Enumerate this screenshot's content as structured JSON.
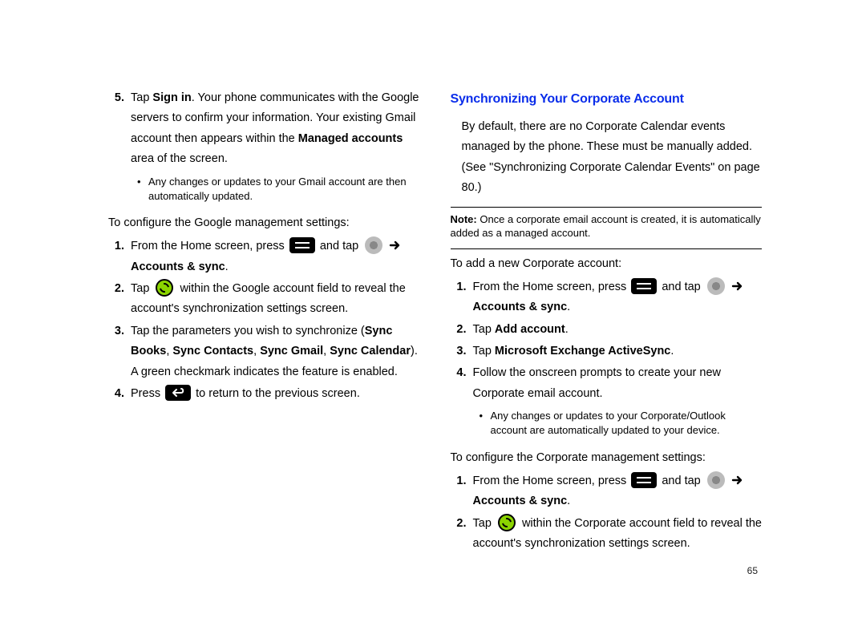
{
  "pageNumber": "65",
  "left": {
    "step5": {
      "num": "5.",
      "pre": "Tap ",
      "bold1": "Sign in",
      "mid1": ". Your phone communicates with the Google servers to confirm your information. Your existing Gmail account then appears within the ",
      "bold2": "Managed accounts",
      "mid2": " area of the screen."
    },
    "bullet1": "Any changes or updates to your Gmail account are then automatically updated.",
    "configGoogle": "To configure the Google management settings:",
    "g1": {
      "num": "1.",
      "pre": "From the Home screen, press ",
      "mid": " and tap ",
      "tail": " ",
      "bold": "Accounts & sync",
      "post": "."
    },
    "g2": {
      "num": "2.",
      "pre": "Tap ",
      "mid": " within the Google account field to reveal the account's synchronization settings screen."
    },
    "g3": {
      "num": "3.",
      "pre": "Tap the parameters you wish to synchronize (",
      "b1": "Sync Books",
      "c1": ", ",
      "b2": "Sync Contacts",
      "c2": ", ",
      "b3": "Sync Gmail",
      "c3": ", ",
      "b4": "Sync Calendar",
      "post": "). A green checkmark indicates the feature is enabled."
    },
    "g4": {
      "num": "4.",
      "pre": "Press ",
      "post": " to return to the previous screen."
    }
  },
  "right": {
    "heading": "Synchronizing Your Corporate Account",
    "intro": "By default, there are no Corporate Calendar events managed by the phone. These must be manually added. (See \"Synchronizing Corporate Calendar Events\" on page 80.)",
    "noteLabel": "Note:",
    "noteBody": " Once a corporate email account is created, it is automatically added as a managed account.",
    "addNew": "To add a new Corporate account:",
    "c1": {
      "num": "1.",
      "pre": "From the Home screen, press ",
      "mid": " and tap ",
      "bold": "Accounts & sync",
      "post": "."
    },
    "c2": {
      "num": "2.",
      "pre": "Tap ",
      "bold": "Add account",
      "post": "."
    },
    "c3": {
      "num": "3.",
      "pre": "Tap ",
      "bold": "Microsoft Exchange ActiveSync",
      "post": "."
    },
    "c4": {
      "num": "4.",
      "text": "Follow the onscreen prompts to create your new Corporate email account."
    },
    "bullet2": "Any changes or updates to your Corporate/Outlook account are automatically updated to your device.",
    "configCorp": "To configure the Corporate management settings:",
    "m1": {
      "num": "1.",
      "pre": "From the Home screen, press ",
      "mid": " and tap ",
      "bold": "Accounts & sync",
      "post": "."
    },
    "m2": {
      "num": "2.",
      "pre": "Tap ",
      "mid": " within the Corporate account field to reveal the account's synchronization settings screen."
    }
  }
}
